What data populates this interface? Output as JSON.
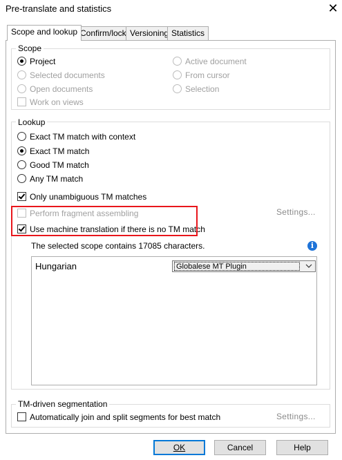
{
  "window": {
    "title": "Pre-translate and statistics"
  },
  "tabs": [
    {
      "label": "Scope and lookup"
    },
    {
      "label": "Confirm/lock"
    },
    {
      "label": "Versioning"
    },
    {
      "label": "Statistics"
    }
  ],
  "scope": {
    "label": "Scope",
    "project": "Project",
    "selected_documents": "Selected documents",
    "open_documents": "Open documents",
    "work_on_views": "Work on views",
    "active_document": "Active document",
    "from_cursor": "From cursor",
    "selection": "Selection"
  },
  "lookup": {
    "label": "Lookup",
    "exact_context": "Exact TM match with context",
    "exact": "Exact TM match",
    "good": "Good TM match",
    "any": "Any TM match",
    "unambiguous": "Only unambiguous TM matches",
    "fragment": "Perform fragment assembling",
    "settings": "Settings...",
    "machine_translation": "Use machine translation if there is no TM match",
    "scope_info": "The selected scope contains 17085 characters.",
    "mt_rows": [
      {
        "language": "Hungarian",
        "plugin": "Globalese MT Plugin"
      }
    ]
  },
  "segmentation": {
    "label": "TM-driven segmentation",
    "auto_join": "Automatically join and split segments for best match",
    "settings": "Settings..."
  },
  "buttons": {
    "ok": "OK",
    "cancel": "Cancel",
    "help": "Help"
  },
  "colors": {
    "highlight_box": "#e8151b",
    "info_icon": "#1e73d8"
  }
}
